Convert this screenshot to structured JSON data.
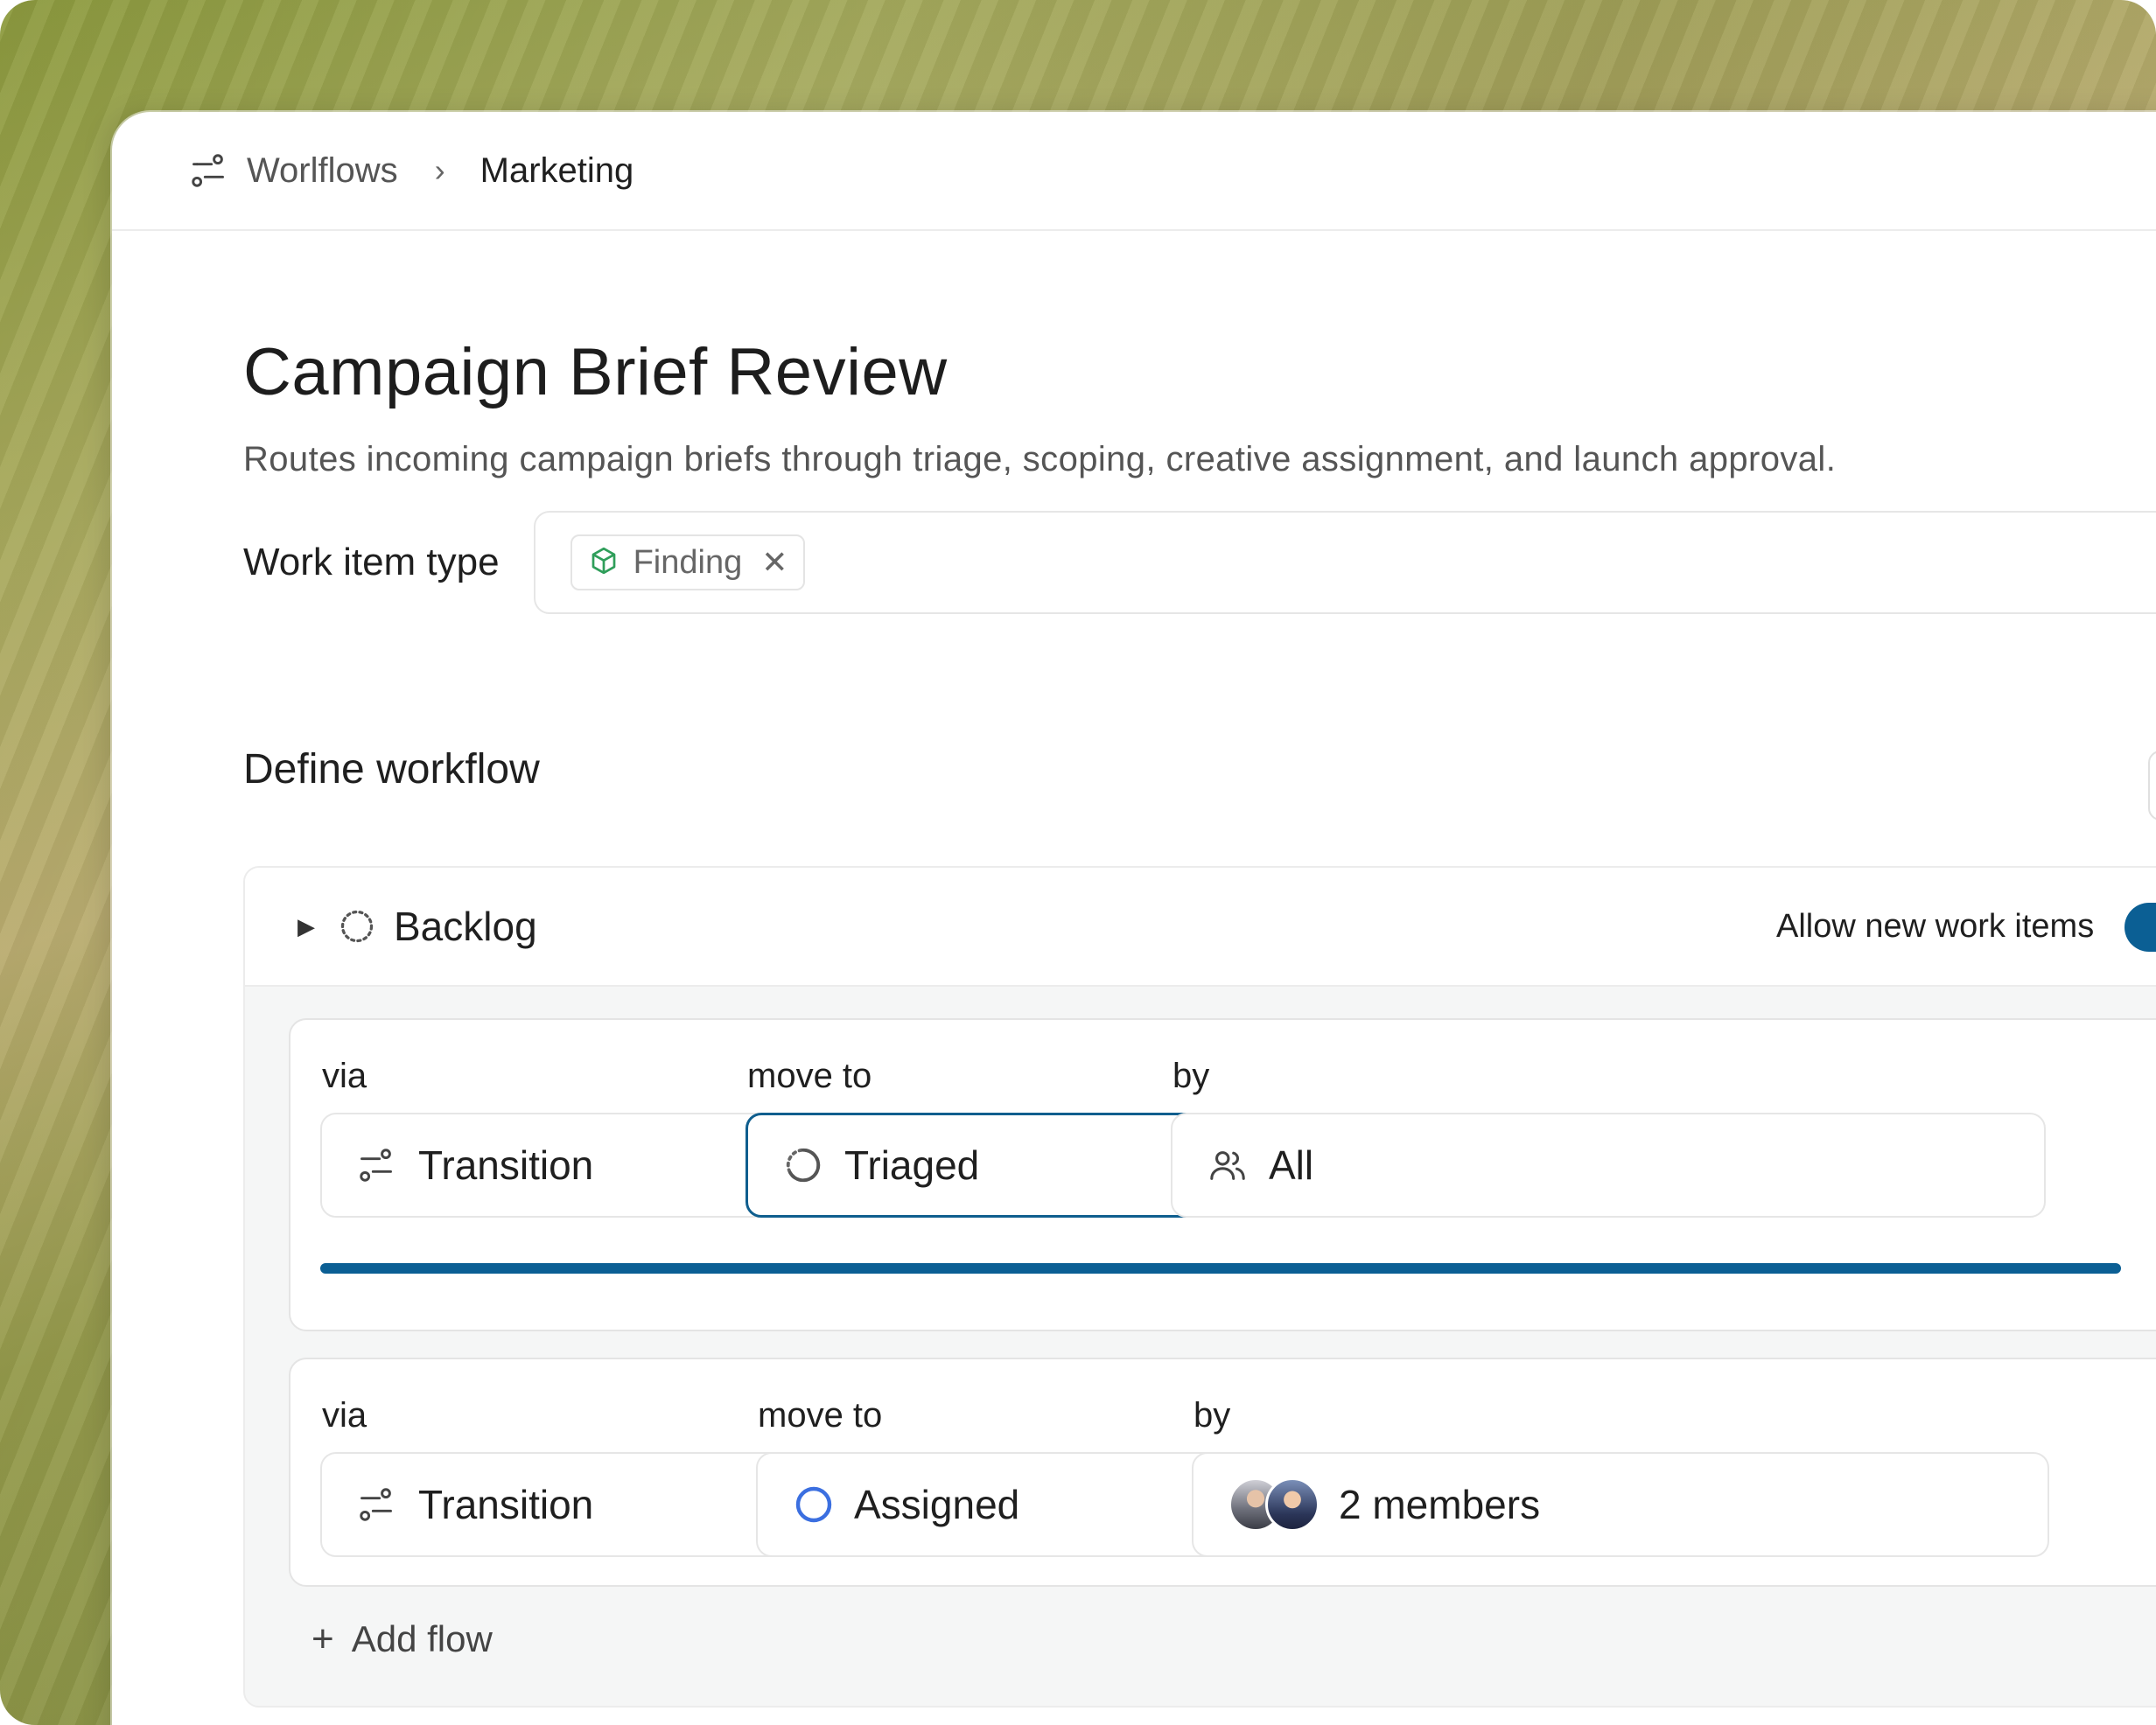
{
  "breadcrumb": {
    "root_label": "Worlflows",
    "current_label": "Marketing"
  },
  "page": {
    "title": "Campaign Brief Review",
    "description": "Routes incoming campaign briefs through triage, scoping, creative assignment, and launch approval."
  },
  "work_item_type": {
    "label": "Work item type",
    "chips": [
      {
        "label": "Finding",
        "icon": "cube-icon",
        "icon_color": "#2f9e5a"
      }
    ]
  },
  "workflow": {
    "section_title": "Define workflow",
    "group": {
      "name": "Backlog",
      "status_icon": "dashed-circle-icon",
      "allow_new_label": "Allow new work items",
      "allow_new_enabled": true,
      "flows": [
        {
          "via_label": "via",
          "via_value": "Transition",
          "move_label": "move to",
          "move_value": "Triaged",
          "move_icon": "progress-circle-icon",
          "by_label": "by",
          "by_value": "All",
          "by_icon": "users-icon",
          "progress_fraction": 1.0
        },
        {
          "via_label": "via",
          "via_value": "Transition",
          "move_label": "move to",
          "move_value": "Assigned",
          "move_icon": "open-circle-icon",
          "by_label": "by",
          "by_value": "2 members",
          "by_icon": "avatar-stack"
        }
      ],
      "add_flow_label": "Add flow"
    }
  },
  "colors": {
    "accent": "#0b5f94",
    "assigned_ring": "#3b6fe0",
    "finding_icon": "#2f9e5a"
  }
}
